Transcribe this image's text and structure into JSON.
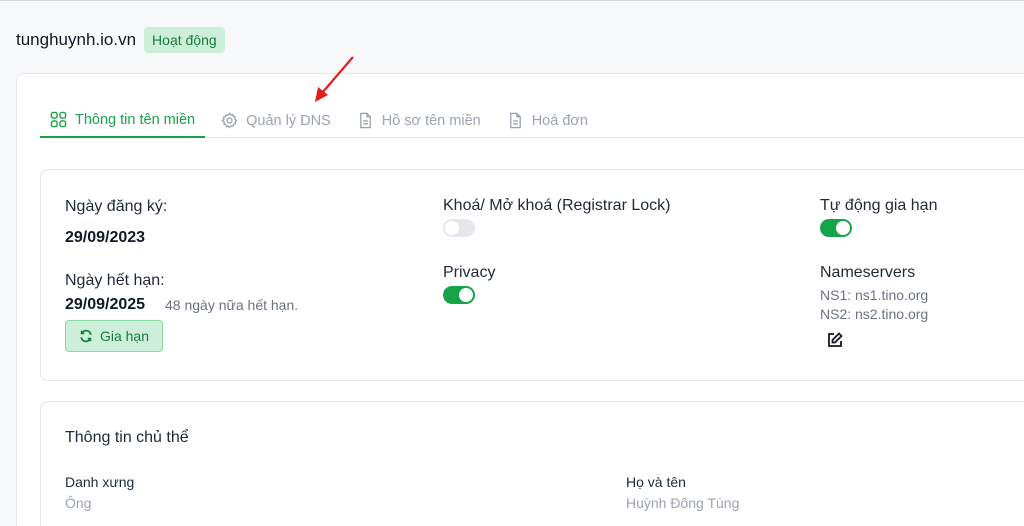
{
  "header": {
    "domain": "tunghuynh.io.vn",
    "status": "Hoạt động"
  },
  "tabs": [
    {
      "label": "Thông tin tên miền",
      "icon": "grid-icon",
      "active": true
    },
    {
      "label": "Quản lý DNS",
      "icon": "gear-icon",
      "active": false
    },
    {
      "label": "Hồ sơ tên miền",
      "icon": "document-icon",
      "active": false
    },
    {
      "label": "Hoá đơn",
      "icon": "document-icon",
      "active": false
    }
  ],
  "registration": {
    "registered_label": "Ngày đăng ký:",
    "registered_date": "29/09/2023",
    "expiry_label": "Ngày hết hạn:",
    "expiry_date": "29/09/2025",
    "expiry_note": "48 ngày nữa hết hạn.",
    "renew_label": "Gia hạn"
  },
  "settings": {
    "lock_label": "Khoá/ Mở khoá (Registrar Lock)",
    "lock_on": false,
    "privacy_label": "Privacy",
    "privacy_on": true,
    "autorenew_label": "Tự động gia hạn",
    "autorenew_on": true
  },
  "nameservers": {
    "label": "Nameservers",
    "ns1": "NS1: ns1.tino.org",
    "ns2": "NS2: ns2.tino.org"
  },
  "owner": {
    "title": "Thông tin chủ thể",
    "salutation_label": "Danh xưng",
    "salutation_value": "Ông",
    "fullname_label": "Họ và tên",
    "fullname_value": "Huỳnh Đông Tùng"
  },
  "colors": {
    "accent": "#16a34a",
    "annotation_arrow": "#e11d1d"
  }
}
